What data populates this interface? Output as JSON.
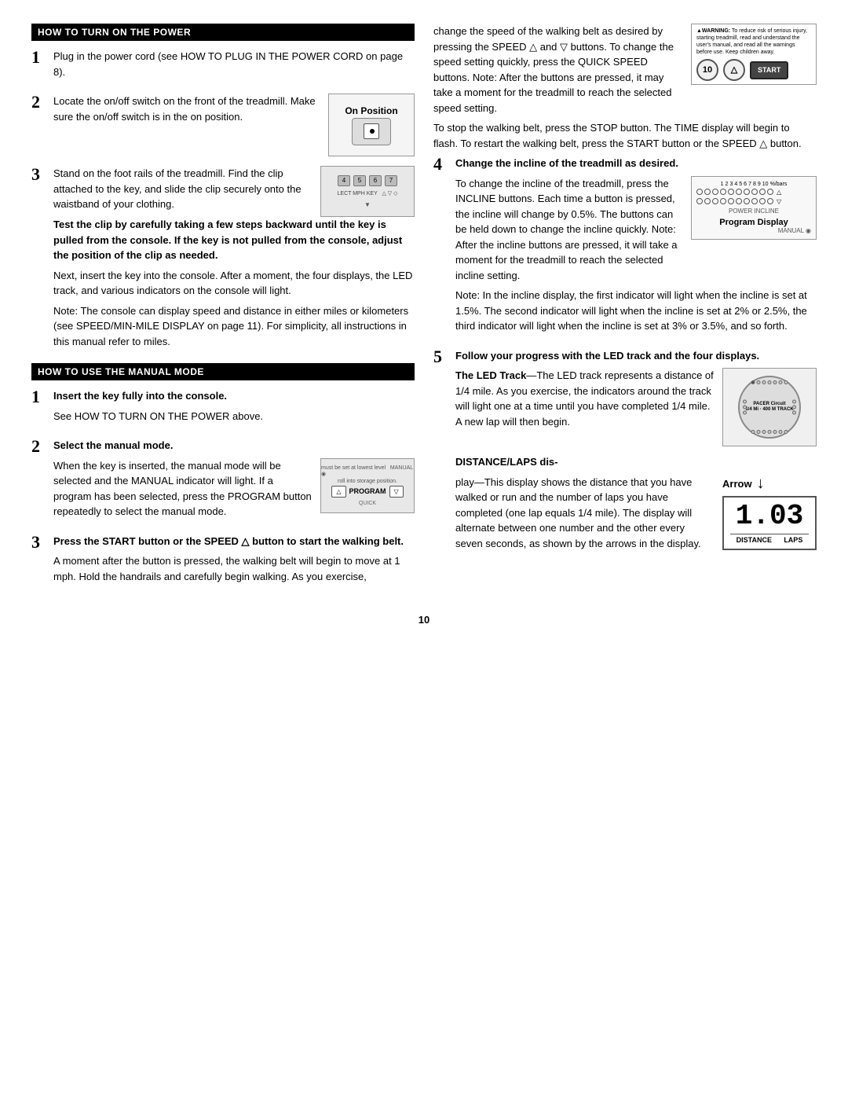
{
  "page": {
    "number": "10"
  },
  "sections": {
    "how_to_turn_on": {
      "title": "HOW TO TURN ON THE POWER",
      "steps": [
        {
          "number": "1",
          "text": "Plug in the power cord (see HOW TO PLUG IN THE POWER CORD on page 8)."
        },
        {
          "number": "2",
          "text": "Locate the on/off switch on the front of the treadmill. Make sure the on/off switch is in the on position.",
          "image_label": "On Position"
        },
        {
          "number": "3",
          "text_parts": [
            "Stand on the foot rails of the treadmill. Find the clip attached to the key, and slide the clip securely onto the waistband of your clothing.",
            "Test the clip by carefully taking a few steps backward until the key is pulled from the console. If the key is not pulled from the console, adjust the position of the clip as needed.",
            "Next, insert the key into the console. After a moment, the four displays, the LED track, and various indicators on the console will light.",
            "Note: The console can display speed and distance in either miles or kilometers (see SPEED/MIN-MILE DISPLAY on page 11). For simplicity, all instructions in this manual refer to miles."
          ]
        }
      ]
    },
    "how_to_use_manual_mode": {
      "title": "HOW TO USE THE MANUAL MODE",
      "steps": [
        {
          "number": "1",
          "bold": true,
          "text": "Insert the key fully into the console.",
          "subtext": "See HOW TO TURN ON THE POWER above."
        },
        {
          "number": "2",
          "bold": true,
          "text": "Select the manual mode.",
          "description": "When the key is inserted, the manual mode will be selected and the MANUAL indicator will light. If a program has been selected, press the PROGRAM button repeatedly to select the manual mode.",
          "manual_image_labels": [
            "must be set at lowest level  MANUAL",
            "roll into storage position."
          ]
        },
        {
          "number": "3",
          "bold": true,
          "text": "Press the START button or the SPEED △ button to start the walking belt.",
          "description": "A moment after the button is pressed, the walking belt will begin to move at 1 mph. Hold the handrails and carefully begin walking. As you exercise,"
        }
      ]
    },
    "right_column": {
      "speed_text": [
        "change the speed of the walking belt as desired by pressing the SPEED △ and ▽ buttons. To change the speed setting quickly, press the QUICK SPEED buttons. Note: After the buttons are pressed, it may take a moment for the treadmill to reach the selected speed setting.",
        "To stop the walking belt, press the STOP button. The TIME display will begin to flash. To restart the walking belt, press the START button or the SPEED △ button."
      ],
      "warning": {
        "title": "▲WARNING:",
        "text": "To reduce risk of serious injury, starting treadmill, read and understand the user's manual, and read all the warnings before use. Keep children away."
      },
      "step4": {
        "number": "4",
        "bold_text": "Change the incline of the treadmill as desired.",
        "description": [
          "To change the incline of the treadmill, press the INCLINE buttons. Each time a button is pressed, the incline will change by 0.5%. The buttons can be held down to change the incline quickly. Note: After the incline buttons are pressed, it will take a moment for the treadmill to reach the selected incline setting.",
          "Note: In the incline display, the first indicator will light when the incline is set at 1.5%. The second indicator will light when the incline is set at 2% or 2.5%, the third indicator will light when the incline is set at 3% or 3.5%, and so forth."
        ],
        "incline_numbers": [
          "1",
          "2",
          "3",
          "4",
          "5",
          "6",
          "7",
          "8",
          "9",
          "10",
          "%/bars"
        ],
        "program_display_label": "Program Display",
        "manual_label": "MANUAL"
      },
      "step5": {
        "number": "5",
        "bold_text": "Follow your progress with the LED track and the four displays.",
        "led_track": {
          "title": "The LED Track",
          "dash": "—",
          "description": "The LED track represents a distance of 1/4 mile. As you exercise, the indicators around the track will light one at a time until you have completed 1/4 mile. A new lap will then begin."
        },
        "pacer_labels": [
          "PACER Circuit",
          "1/4 Mi · 400 M TRACK"
        ],
        "distance_laps": {
          "title": "DISTANCE/LAPS dis-",
          "description_parts": [
            "play—This display shows the distance that you have walked or run and the number of laps you have completed (one lap equals 1/4 mile). The display will alternate between one number and the other every seven seconds, as shown by the arrows in the display."
          ],
          "arrow_label": "Arrow",
          "display_value": "1.03",
          "distance_label": "DISTANCE",
          "laps_label": "LAPS"
        }
      }
    }
  }
}
